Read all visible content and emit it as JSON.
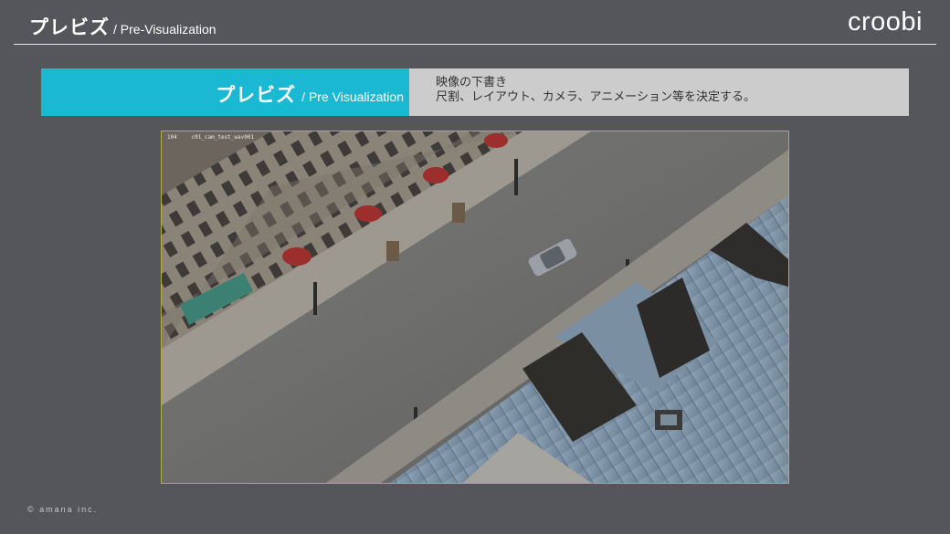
{
  "header": {
    "title_jp": "プレビズ",
    "title_en": "/ Pre-Visualization",
    "logo": "croobi"
  },
  "banner": {
    "title_jp": "プレビズ",
    "title_en": "/ Pre Visualization",
    "line1": "映像の下書き",
    "line2": "尺割、レイアウト、カメラ、アニメーション等を決定する。"
  },
  "viewport": {
    "frame_label": "104",
    "shot_label": "c01_cam_test_wav001"
  },
  "footer": {
    "copyright": "© amana inc."
  },
  "colors": {
    "background": "#54565b",
    "accent": "#1ab8d2",
    "banner_gray": "#cccccc",
    "viewport_border": "#b7ae3a"
  }
}
